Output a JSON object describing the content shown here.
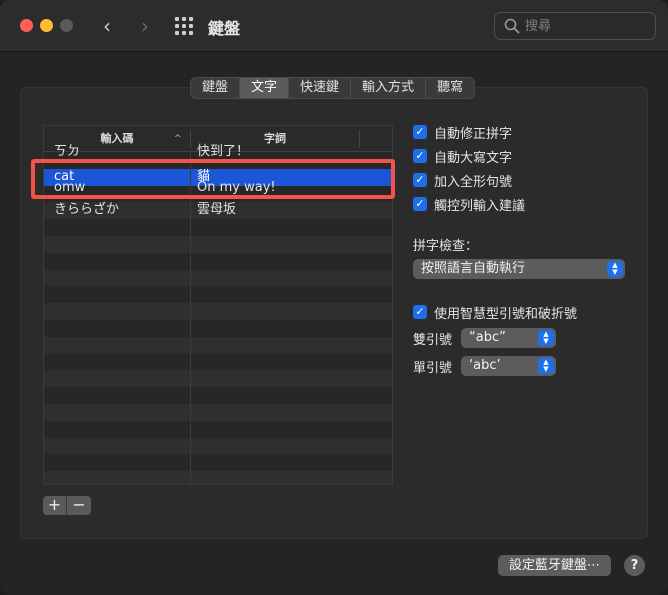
{
  "window": {
    "title": "鍵盤"
  },
  "search": {
    "placeholder": "搜尋"
  },
  "tabs": [
    {
      "label": "鍵盤",
      "active": false
    },
    {
      "label": "文字",
      "active": true
    },
    {
      "label": "快速鍵",
      "active": false
    },
    {
      "label": "輸入方式",
      "active": false
    },
    {
      "label": "聽寫",
      "active": false
    }
  ],
  "table": {
    "col_input": "輸入碼",
    "col_phrase": "字詞",
    "sort_indicator": "^",
    "rows": [
      {
        "input": "ㄎㄉ",
        "phrase": "快到了！"
      },
      {
        "input": "cat",
        "phrase": "貓"
      },
      {
        "input": "omw",
        "phrase": "On my way!"
      },
      {
        "input": "きららざか",
        "phrase": "雲母坂"
      }
    ]
  },
  "buttons": {
    "add": "+",
    "remove": "−",
    "bluetooth": "設定藍牙鍵盤⋯",
    "help": "?"
  },
  "checkboxes": {
    "auto_correct": "自動修正拼字",
    "auto_capitalize": "自動大寫文字",
    "add_period": "加入全形句號",
    "touch_bar": "觸控列輸入建議",
    "smart_quotes": "使用智慧型引號和破折號"
  },
  "spelling": {
    "label": "拼字檢查：",
    "value": "按照語言自動執行"
  },
  "double_quotes": {
    "label": "雙引號",
    "value": "“abc”"
  },
  "single_quotes": {
    "label": "單引號",
    "value": "‘abc’"
  },
  "colors": {
    "selection": "#1a56d6",
    "accent": "#1f6feb",
    "highlight": "#f0544a"
  }
}
